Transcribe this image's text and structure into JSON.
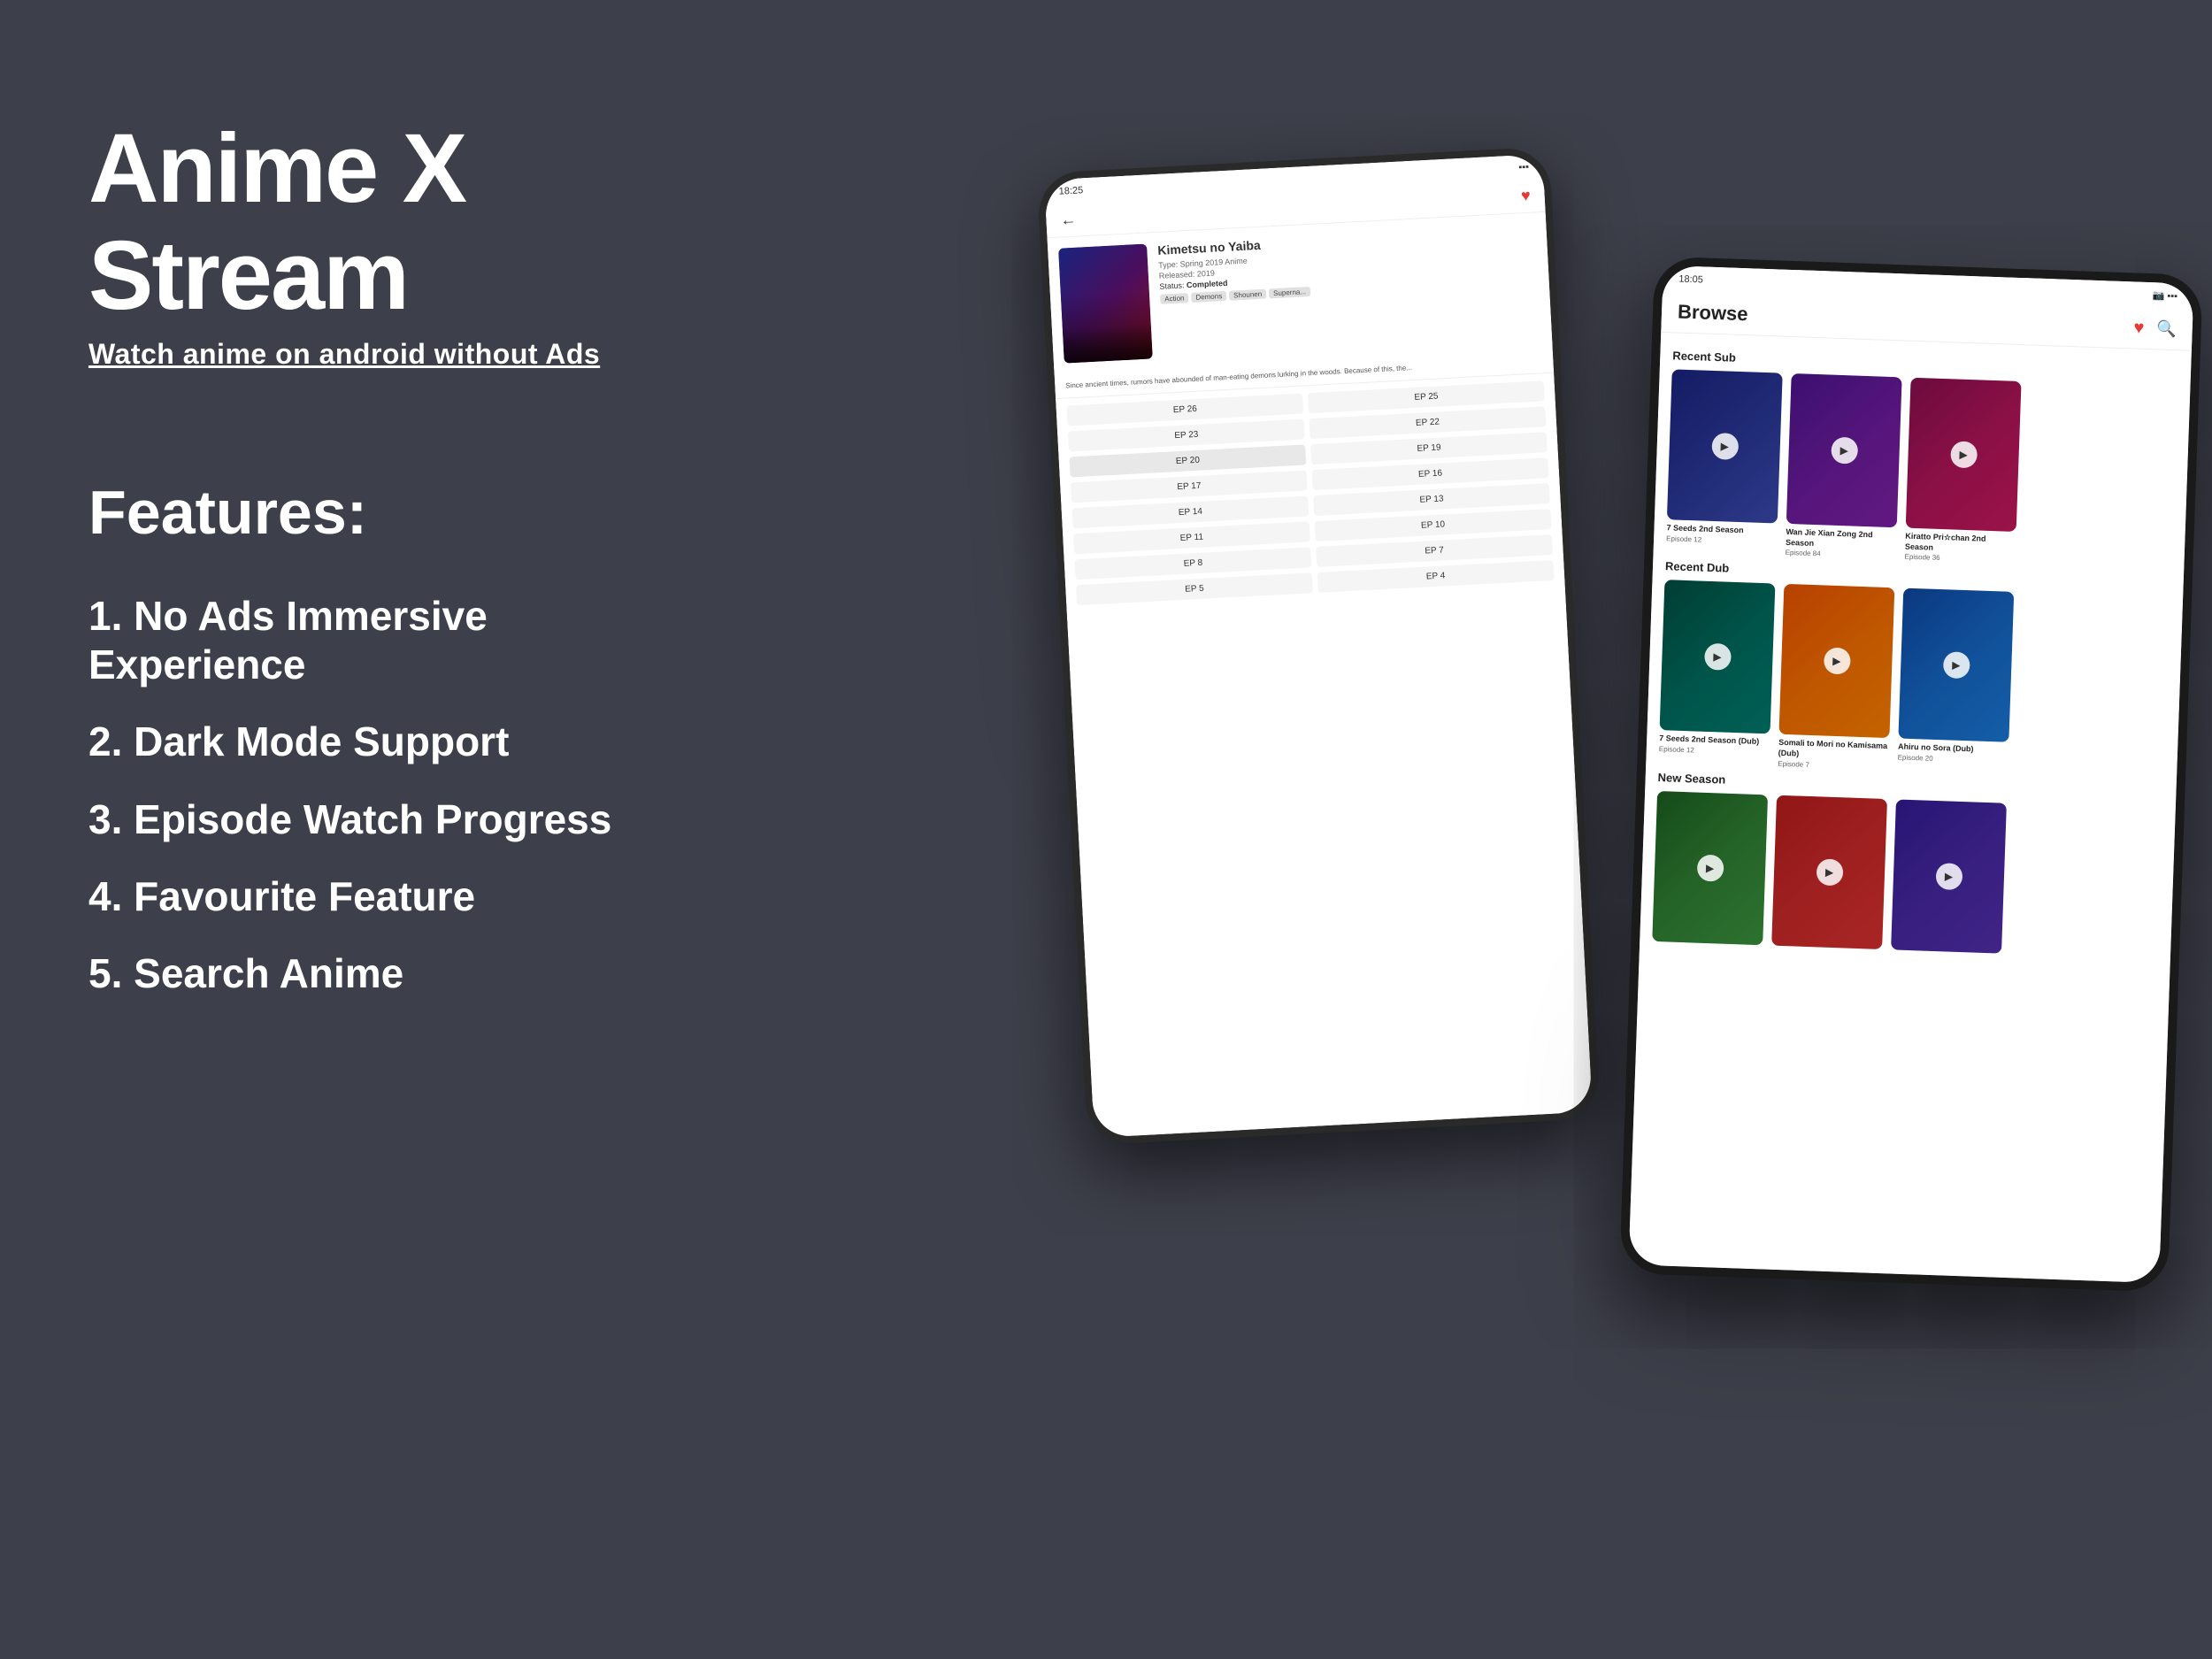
{
  "background_color": "#3d3f4a",
  "header": {
    "title": "Anime X Stream",
    "subtitle": "Watch anime on android without Ads"
  },
  "features": {
    "heading": "Features:",
    "items": [
      "1. No Ads Immersive Experience",
      "2. Dark Mode Support",
      "3. Episode Watch Progress",
      "4. Favourite Feature",
      "5. Search Anime"
    ]
  },
  "phone_back": {
    "status_time": "18:25",
    "anime_title": "Kimetsu no Yaiba",
    "anime_type": "Type: Spring 2019 Anime",
    "anime_released": "Released: 2019",
    "anime_status": "Status: Completed",
    "anime_tags": [
      "Action",
      "Demons",
      "Shounen",
      "Superna..."
    ],
    "anime_description": "Since ancient times, rumors have abounded of man-eating demons lurking in the woods. Because of this, the...",
    "episodes": [
      "EP 26",
      "EP 25",
      "EP 23",
      "EP 22",
      "EP 20",
      "EP 19",
      "EP 17",
      "EP 16",
      "EP 14",
      "EP 13",
      "EP 11",
      "EP 10",
      "EP 8",
      "EP 7",
      "EP 5",
      "EP 4"
    ]
  },
  "phone_front": {
    "status_time": "18:05",
    "header_title": "Browse",
    "recent_sub_label": "Recent Sub",
    "recent_dub_label": "Recent Dub",
    "new_season_label": "New Season",
    "recent_sub_items": [
      {
        "name": "7 Seeds 2nd Season",
        "episode": "Episode 12"
      },
      {
        "name": "Wan Jie Xian Zong 2nd Season",
        "episode": "Episode 84"
      },
      {
        "name": "Kiratto Pri☆chan 2nd Season",
        "episode": "Episode 36"
      }
    ],
    "recent_dub_items": [
      {
        "name": "7 Seeds 2nd Season (Dub)",
        "episode": "Episode 12"
      },
      {
        "name": "Somali to Mori no Kamisama (Dub)",
        "episode": "Episode 7"
      },
      {
        "name": "Ahiru no Sora (Dub)",
        "episode": "Episode 20"
      }
    ]
  }
}
